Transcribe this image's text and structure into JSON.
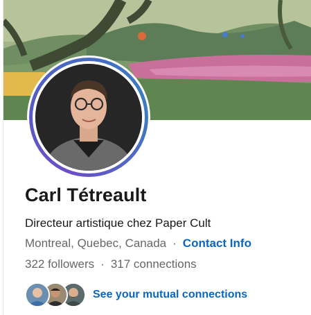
{
  "profile": {
    "name": "Carl Tétreault",
    "headline": "Directeur artistique chez Paper Cult",
    "location": "Montreal, Quebec, Canada",
    "separator": "·",
    "contact_info_label": "Contact Info",
    "followers": "322 followers",
    "connections": "317 connections",
    "mutual_connections_label": "See your mutual connections"
  },
  "icons": {
    "cover": "illustrated-landscape-cover-image",
    "avatar": "profile-photo",
    "mutual_avatars": [
      "mutual-connection-avatar",
      "mutual-connection-avatar",
      "mutual-connection-avatar"
    ]
  },
  "colors": {
    "link": "#0a66c2",
    "text_primary": "#191919",
    "text_secondary": "#666666",
    "avatar_ring_start": "#6b4ec8",
    "avatar_ring_end": "#3a7ec1"
  }
}
